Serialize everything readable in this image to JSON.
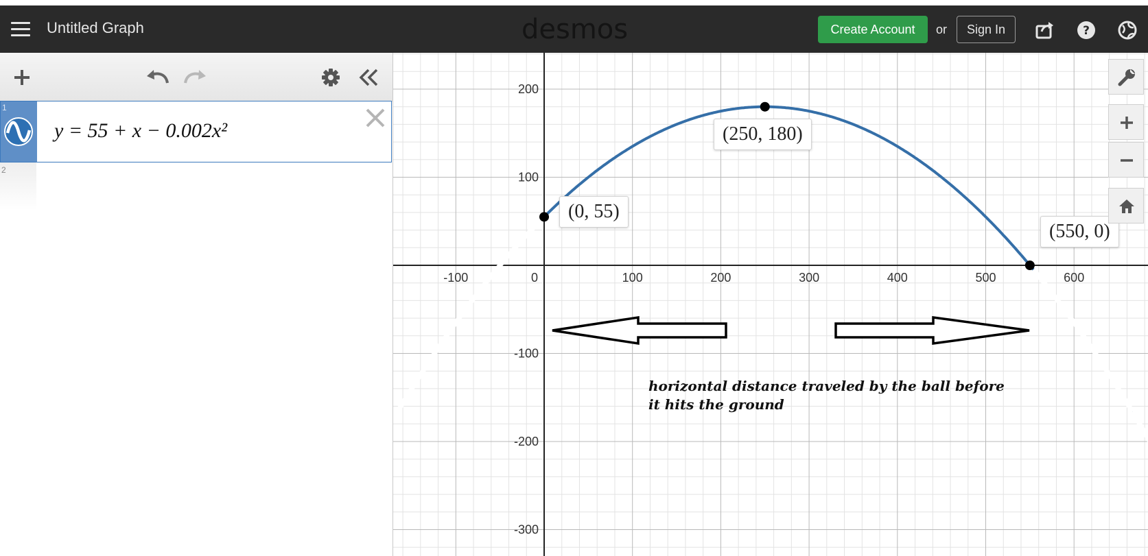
{
  "header": {
    "title": "Untitled Graph",
    "logo": "desmos",
    "create_account": "Create Account",
    "or": "or",
    "sign_in": "Sign In",
    "icons": [
      "hamburger-icon",
      "share-icon",
      "help-icon",
      "globe-icon"
    ]
  },
  "expression_list": {
    "toolbar_icons": [
      "plus-icon",
      "undo-icon",
      "redo-icon",
      "gear-icon",
      "collapse-icon"
    ],
    "expressions": [
      {
        "index": "1",
        "latex": "y = 55 + x − 0.002x²",
        "color": "#2d70b3"
      },
      {
        "index": "2",
        "latex": ""
      }
    ]
  },
  "graph": {
    "x_ticks": [
      "-100",
      "0",
      "100",
      "200",
      "300",
      "400",
      "500",
      "600"
    ],
    "y_ticks": [
      "200",
      "100",
      "-100",
      "-200",
      "-300"
    ],
    "points": [
      {
        "x": 0,
        "y": 55,
        "label": "(0, 55)"
      },
      {
        "x": 250,
        "y": 180,
        "label": "(250, 180)"
      },
      {
        "x": 550,
        "y": 0,
        "label": "(550, 0)"
      }
    ],
    "annotation_line1": "horizontal distance traveled by the ball before",
    "annotation_line2": "it hits the ground",
    "curve_color": "#356fa8",
    "controls": [
      "wrench-icon",
      "zoom-in-icon",
      "zoom-out-icon",
      "home-icon"
    ]
  }
}
